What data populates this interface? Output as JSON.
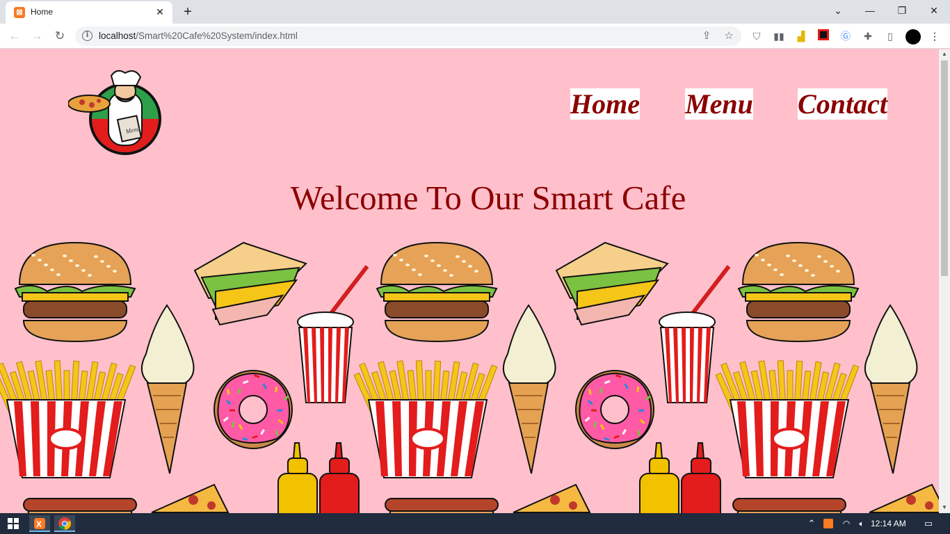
{
  "browser": {
    "tab": {
      "title": "Home",
      "favicon": "xampp-favicon-icon"
    },
    "new_tab": "+",
    "window_controls": [
      "chevron-down-icon",
      "minimize-icon",
      "restore-icon",
      "close-icon"
    ],
    "url": {
      "host": "localhost",
      "path": "/Smart%20Cafe%20System/index.html"
    },
    "extensions": [
      "shield-extension-icon",
      "bars-extension-icon",
      "chart-extension-icon",
      "red-extension-icon",
      "translate-extension-icon",
      "puzzle-icon",
      "side-panel-icon",
      "profile-avatar"
    ]
  },
  "site": {
    "logo": "chef-pizza-logo",
    "nav": [
      "Home",
      "Menu",
      "Contact"
    ],
    "heading": "Welcome To Our Smart Cafe"
  },
  "colors": {
    "page_background": "#ffc0cb",
    "brand_red": "#8b0000",
    "nav_background": "#ffffff"
  },
  "background_pattern": [
    "burger",
    "sandwich",
    "soda-cup",
    "ice-cream-cone",
    "donut",
    "french-fries",
    "mustard-bottle",
    "ketchup-bottle",
    "hot-dog",
    "pizza-slice"
  ],
  "taskbar": {
    "time": "12:14 AM",
    "apps": [
      "windows-start-icon",
      "xampp-taskbar-icon",
      "chrome-taskbar-icon"
    ]
  }
}
